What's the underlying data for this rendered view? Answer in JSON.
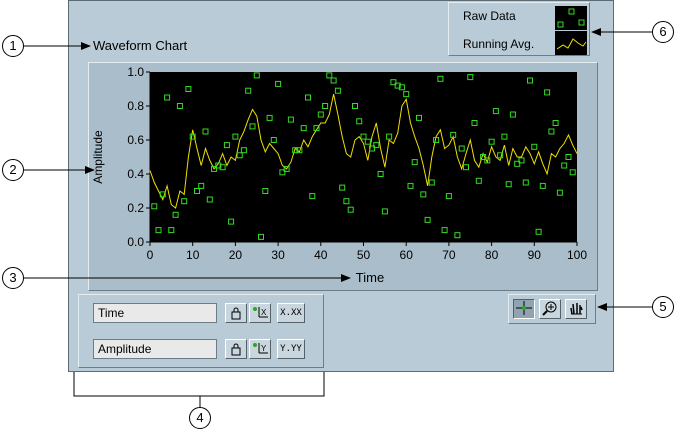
{
  "chart_title": "Waveform Chart",
  "legend": {
    "items": [
      {
        "label": "Raw Data",
        "icon": "square-marker",
        "color": "#33dd22"
      },
      {
        "label": "Running Avg.",
        "icon": "line-trace",
        "color": "#f0e000"
      }
    ]
  },
  "scale_legend": {
    "rows": [
      {
        "name": "Time",
        "lock_icon": "lock-icon",
        "autoscale_icon": "x-autoscale-icon",
        "format_label": "X.XX"
      },
      {
        "name": "Amplitude",
        "lock_icon": "lock-icon",
        "autoscale_icon": "y-autoscale-icon",
        "format_label": "Y.YY"
      }
    ]
  },
  "graph_palette": {
    "tools": [
      "cursor-crosshair-icon",
      "zoom-icon",
      "pan-hand-icon"
    ]
  },
  "callouts": [
    "1",
    "2",
    "3",
    "4",
    "5",
    "6"
  ],
  "colors": {
    "panel": "#b9cbd6",
    "plot_bg": "#000000",
    "raw": "#33dd22",
    "avg": "#f0e000"
  },
  "chart_data": {
    "type": "scatter",
    "xlabel": "Time",
    "ylabel": "Amplitude",
    "xlim": [
      0,
      100
    ],
    "ylim": [
      0,
      1
    ],
    "x_ticks": [
      "0",
      "10",
      "20",
      "30",
      "40",
      "50",
      "60",
      "70",
      "80",
      "90",
      "100"
    ],
    "y_ticks": [
      "0.0",
      "0.2",
      "0.4",
      "0.6",
      "0.8",
      "1.0"
    ],
    "grid": false,
    "series": [
      {
        "name": "Raw Data",
        "style": "markers",
        "x": [
          1,
          2,
          3,
          4,
          5,
          6,
          7,
          8,
          9,
          10,
          11,
          12,
          13,
          14,
          15,
          16,
          17,
          18,
          19,
          20,
          21,
          22,
          23,
          24,
          25,
          26,
          27,
          28,
          29,
          30,
          31,
          32,
          33,
          34,
          35,
          36,
          37,
          38,
          39,
          40,
          41,
          42,
          43,
          44,
          45,
          46,
          47,
          48,
          49,
          50,
          51,
          52,
          53,
          54,
          55,
          56,
          57,
          58,
          59,
          60,
          61,
          62,
          63,
          64,
          65,
          66,
          67,
          68,
          69,
          70,
          71,
          72,
          73,
          74,
          75,
          76,
          77,
          78,
          79,
          80,
          81,
          82,
          83,
          84,
          85,
          86,
          87,
          88,
          89,
          90,
          91,
          92,
          93,
          94,
          95,
          96,
          97,
          98,
          99
        ],
        "y": [
          0.21,
          0.07,
          0.28,
          0.85,
          0.07,
          0.16,
          0.8,
          0.24,
          0.9,
          0.62,
          0.3,
          0.33,
          0.65,
          0.25,
          0.43,
          0.45,
          0.44,
          0.57,
          0.12,
          0.62,
          0.51,
          0.54,
          0.89,
          0.68,
          0.98,
          0.03,
          0.3,
          0.73,
          0.6,
          0.93,
          0.41,
          0.43,
          0.72,
          0.54,
          0.54,
          0.67,
          0.85,
          0.27,
          0.67,
          0.75,
          0.8,
          0.98,
          0.95,
          0.89,
          0.32,
          0.24,
          0.19,
          0.8,
          0.71,
          0.62,
          0.59,
          0.55,
          0.57,
          0.4,
          0.18,
          0.62,
          0.94,
          0.92,
          0.91,
          0.87,
          0.33,
          0.47,
          0.73,
          0.28,
          0.13,
          0.35,
          0.6,
          0.96,
          0.07,
          0.27,
          0.63,
          0.04,
          0.55,
          0.44,
          0.97,
          0.7,
          0.36,
          0.5,
          0.48,
          0.59,
          0.77,
          0.51,
          0.62,
          0.34,
          0.75,
          0.46,
          0.48,
          0.35,
          0.95,
          0.56,
          0.06,
          0.33,
          0.88,
          0.65,
          0.7,
          0.29,
          0.45,
          0.5,
          0.41
        ]
      },
      {
        "name": "Running Avg.",
        "style": "line",
        "x": [
          0,
          1,
          2,
          3,
          4,
          5,
          6,
          7,
          8,
          9,
          10,
          11,
          12,
          13,
          14,
          15,
          16,
          17,
          18,
          19,
          20,
          21,
          22,
          23,
          24,
          25,
          26,
          27,
          28,
          29,
          30,
          31,
          32,
          33,
          34,
          35,
          36,
          37,
          38,
          39,
          40,
          41,
          42,
          43,
          44,
          45,
          46,
          47,
          48,
          49,
          50,
          51,
          52,
          53,
          54,
          55,
          56,
          57,
          58,
          59,
          60,
          61,
          62,
          63,
          64,
          65,
          66,
          67,
          68,
          69,
          70,
          71,
          72,
          73,
          74,
          75,
          76,
          77,
          78,
          79,
          80,
          81,
          82,
          83,
          84,
          85,
          86,
          87,
          88,
          89,
          90,
          91,
          92,
          93,
          94,
          95,
          96,
          97,
          98,
          99,
          100
        ],
        "y": [
          0.42,
          0.35,
          0.3,
          0.25,
          0.33,
          0.22,
          0.2,
          0.3,
          0.28,
          0.5,
          0.66,
          0.55,
          0.45,
          0.55,
          0.48,
          0.43,
          0.46,
          0.52,
          0.45,
          0.5,
          0.48,
          0.6,
          0.65,
          0.72,
          0.78,
          0.74,
          0.6,
          0.53,
          0.58,
          0.55,
          0.52,
          0.45,
          0.43,
          0.47,
          0.55,
          0.53,
          0.6,
          0.56,
          0.62,
          0.66,
          0.7,
          0.7,
          0.75,
          0.87,
          0.75,
          0.62,
          0.52,
          0.5,
          0.6,
          0.62,
          0.58,
          0.48,
          0.62,
          0.7,
          0.55,
          0.44,
          0.6,
          0.58,
          0.64,
          0.8,
          0.84,
          0.7,
          0.62,
          0.55,
          0.45,
          0.33,
          0.5,
          0.62,
          0.66,
          0.55,
          0.57,
          0.62,
          0.5,
          0.43,
          0.52,
          0.6,
          0.48,
          0.44,
          0.52,
          0.47,
          0.56,
          0.5,
          0.48,
          0.57,
          0.45,
          0.55,
          0.5,
          0.5,
          0.56,
          0.52,
          0.46,
          0.53,
          0.46,
          0.4,
          0.52,
          0.5,
          0.55,
          0.58,
          0.63,
          0.57,
          0.52
        ]
      }
    ]
  }
}
